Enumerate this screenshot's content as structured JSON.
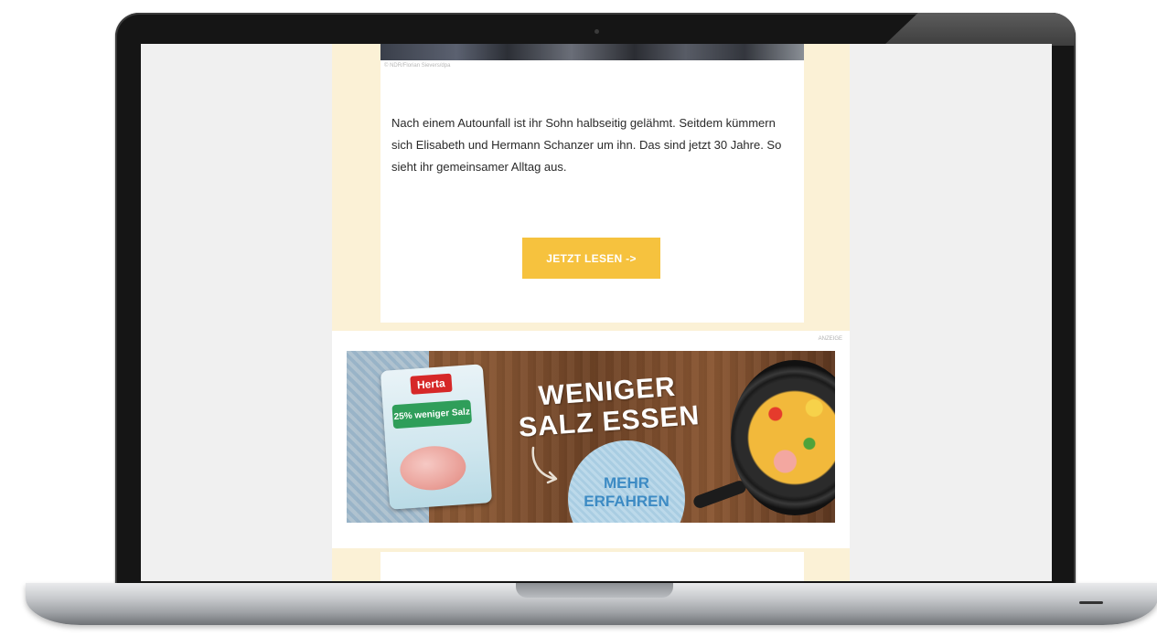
{
  "article": {
    "photo_credit": "© NDR/Florian Sievers/dpa",
    "body": "Nach einem Autounfall ist ihr Sohn halbseitig gelähmt. Seitdem kümmern sich Elisabeth und Hermann Schanzer um ihn. Das sind jetzt 30 Jahre. So sieht ihr gemeinsamer Alltag aus.",
    "cta_label": "JETZT LESEN ->"
  },
  "ad": {
    "label": "ANZEIGE",
    "brand": "Herta",
    "pack_badge": "25% weniger Salz",
    "headline": "WENIGER SALZ ESSEN",
    "more_label": "MEHR ERFAHREN"
  },
  "colors": {
    "page_background": "#f0f0f0",
    "column_background": "#fbf1d6",
    "cta_button": "#f6c23e",
    "more_text": "#3d8bc4",
    "brand_red": "#d62828"
  },
  "icons": [
    "camera-icon",
    "arrow-icon"
  ]
}
